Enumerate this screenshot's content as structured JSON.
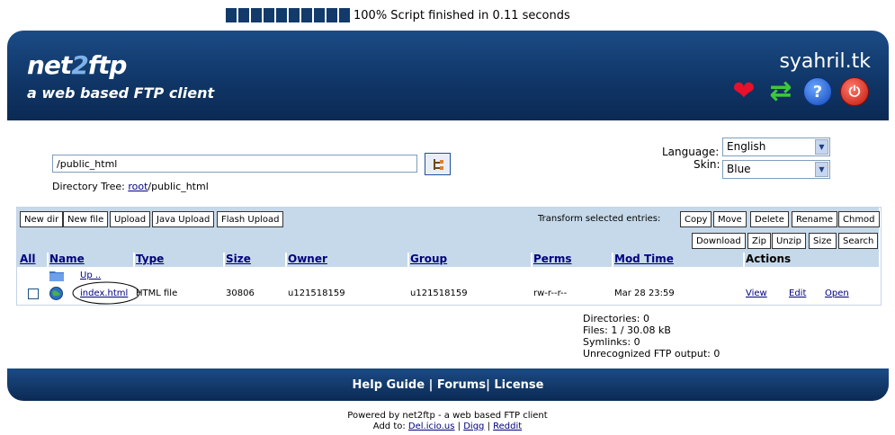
{
  "progress": {
    "blocks": 10,
    "text": "100% Script finished in 0.11 seconds"
  },
  "header": {
    "logo_a": "net",
    "logo_b": "2",
    "logo_c": "ftp",
    "tagline": "a web based FTP client",
    "site": "syahril.tk",
    "icons": [
      "heart-icon",
      "refresh-icon",
      "help-icon",
      "logout-icon"
    ]
  },
  "directory": {
    "path": "/public_html",
    "tree_label": "Directory Tree:",
    "tree_root": "root",
    "tree_rest": "/public_html"
  },
  "prefs": {
    "language_label": "Language:",
    "language_value": "English",
    "skin_label": "Skin:",
    "skin_value": "Blue"
  },
  "toolbar": {
    "left_buttons": [
      "New dir",
      "New file",
      "Upload",
      "Java Upload",
      "Flash Upload"
    ],
    "transform_label": "Transform selected entries:",
    "right_buttons_row1": [
      "Copy",
      "Move",
      "Delete",
      "Rename",
      "Chmod"
    ],
    "right_buttons_row2": [
      "Download",
      "Zip",
      "Unzip",
      "Size",
      "Search"
    ]
  },
  "table": {
    "headers": {
      "all": "All",
      "name": "Name",
      "type": "Type",
      "size": "Size",
      "owner": "Owner",
      "group": "Group",
      "perms": "Perms",
      "modtime": "Mod Time",
      "actions": "Actions"
    },
    "up_label": "Up ..",
    "file": {
      "name": "index.html",
      "type": "HTML file",
      "size": "30806",
      "owner": "u121518159",
      "group": "u121518159",
      "perms": "rw-r--r--",
      "modtime": "Mar 28 23:59",
      "view": "View",
      "edit": "Edit",
      "open": "Open"
    }
  },
  "stats": {
    "directories": "Directories: 0",
    "files": "Files: 1 / 30.08 kB",
    "symlinks": "Symlinks: 0",
    "unrecognized": "Unrecognized FTP output: 0"
  },
  "footer": {
    "help": "Help Guide",
    "sep1": " | ",
    "forums": "Forums",
    "sep2": "| ",
    "license": "License"
  },
  "powered": {
    "line1": "Powered by net2ftp - a web based FTP client",
    "add_to": "Add to:",
    "delicious": "Del.icio.us",
    "sep": "|",
    "digg": "Digg",
    "reddit": "Reddit"
  },
  "colors": {
    "header_bg": "#0f3566",
    "toolbar_bg": "#c6d9ea",
    "link": "#000080"
  }
}
